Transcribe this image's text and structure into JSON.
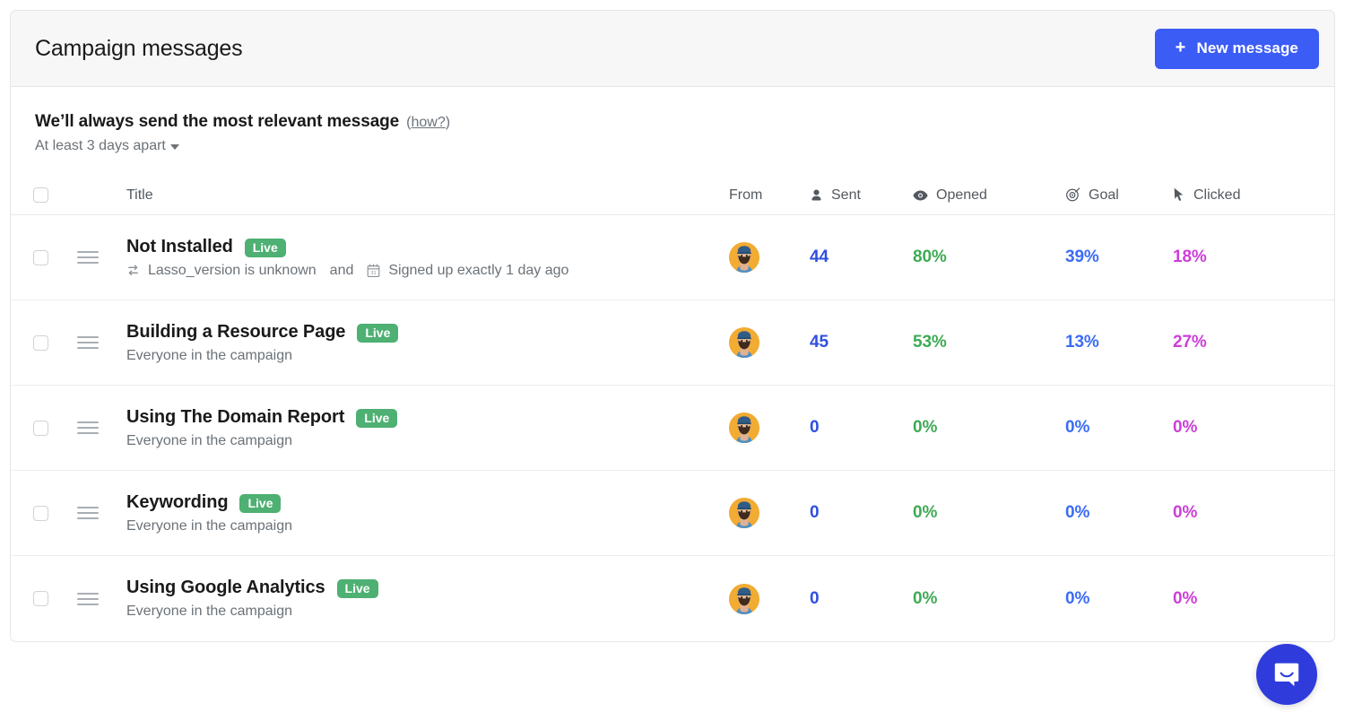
{
  "header": {
    "title": "Campaign messages",
    "new_message_label": "New message",
    "new_message_plus": "+",
    "accent_color": "#3b5cf5"
  },
  "intro": {
    "heading": "We’ll always send the most relevant message",
    "how_link": "how?",
    "how_paren_open": "(",
    "how_paren_close": ")",
    "frequency": "At least 3 days apart"
  },
  "table": {
    "columns": [
      {
        "key": "title",
        "label": "Title",
        "icon": ""
      },
      {
        "key": "from",
        "label": "From",
        "icon": ""
      },
      {
        "key": "sent",
        "label": "Sent",
        "icon": "person-icon"
      },
      {
        "key": "opened",
        "label": "Opened",
        "icon": "eye-icon"
      },
      {
        "key": "goal",
        "label": "Goal",
        "icon": "target-icon"
      },
      {
        "key": "clicked",
        "label": "Clicked",
        "icon": "cursor-icon"
      }
    ],
    "rows": [
      {
        "title": "Not Installed",
        "badge": "Live",
        "audience": "",
        "conditions": [
          {
            "icon": "transfer-icon",
            "text": "Lasso_version is unknown"
          },
          {
            "icon": "calendar-icon",
            "text": "Signed up exactly 1 day ago"
          }
        ],
        "conjunction": "and",
        "sent": "44",
        "opened": "80%",
        "goal": "39%",
        "clicked": "18%"
      },
      {
        "title": "Building a Resource Page",
        "badge": "Live",
        "audience": "Everyone in the campaign",
        "conditions": [],
        "conjunction": "",
        "sent": "45",
        "opened": "53%",
        "goal": "13%",
        "clicked": "27%"
      },
      {
        "title": "Using The Domain Report",
        "badge": "Live",
        "audience": "Everyone in the campaign",
        "conditions": [],
        "conjunction": "",
        "sent": "0",
        "opened": "0%",
        "goal": "0%",
        "clicked": "0%"
      },
      {
        "title": "Keywording",
        "badge": "Live",
        "audience": "Everyone in the campaign",
        "conditions": [],
        "conjunction": "",
        "sent": "0",
        "opened": "0%",
        "goal": "0%",
        "clicked": "0%"
      },
      {
        "title": "Using Google Analytics",
        "badge": "Live",
        "audience": "Everyone in the campaign",
        "conditions": [],
        "conjunction": "",
        "sent": "0",
        "opened": "0%",
        "goal": "0%",
        "clicked": "0%"
      }
    ]
  },
  "colors": {
    "badge_live": "#4eb072",
    "sent": "#2f4fe0",
    "opened": "#3faa55",
    "goal": "#3b6cf5",
    "clicked": "#cc3fd8",
    "intercom": "#2f3cdb"
  },
  "intercom": {
    "icon": "intercom-messenger-icon"
  }
}
